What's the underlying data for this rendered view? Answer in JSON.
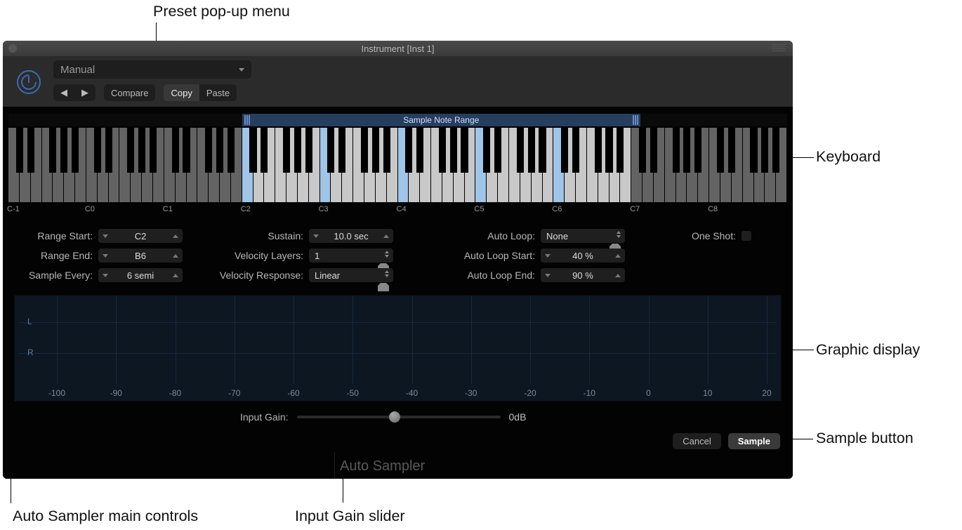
{
  "callouts": {
    "preset": "Preset pop-up menu",
    "keyboard": "Keyboard",
    "graphic": "Graphic display",
    "sample_btn": "Sample button",
    "main_controls": "Auto Sampler main controls",
    "input_gain": "Input Gain slider"
  },
  "titlebar": "Instrument [Inst 1]",
  "preset_menu": "Manual",
  "toolbar": {
    "prev": "◀",
    "next": "▶",
    "compare": "Compare",
    "copy": "Copy",
    "paste": "Paste"
  },
  "range_bar_label": "Sample Note Range",
  "note_labels": [
    "C-1",
    "C0",
    "C1",
    "C2",
    "C3",
    "C4",
    "C5",
    "C6",
    "C7",
    "C8"
  ],
  "params": {
    "range_start": {
      "label": "Range Start:",
      "value": "C2"
    },
    "range_end": {
      "label": "Range End:",
      "value": "B6"
    },
    "sample_every": {
      "label": "Sample Every:",
      "value": "6 semi"
    },
    "sustain": {
      "label": "Sustain:",
      "value": "10.0 sec"
    },
    "vel_layers": {
      "label": "Velocity Layers:",
      "value": "1"
    },
    "vel_resp": {
      "label": "Velocity Response:",
      "value": "Linear"
    },
    "auto_loop": {
      "label": "Auto Loop:",
      "value": "None"
    },
    "auto_loop_start": {
      "label": "Auto Loop Start:",
      "value": "40 %"
    },
    "auto_loop_end": {
      "label": "Auto Loop End:",
      "value": "90 %"
    },
    "one_shot": {
      "label": "One Shot:"
    }
  },
  "graphic": {
    "L": "L",
    "R": "R",
    "db_ticks": [
      "-100",
      "-90",
      "-80",
      "-70",
      "-60",
      "-50",
      "-40",
      "-30",
      "-20",
      "-10",
      "0",
      "10",
      "20"
    ]
  },
  "input_gain": {
    "label": "Input Gain:",
    "value_text": "0dB",
    "position_pct": 48
  },
  "buttons": {
    "cancel": "Cancel",
    "sample": "Sample"
  },
  "footer": "Auto Sampler"
}
